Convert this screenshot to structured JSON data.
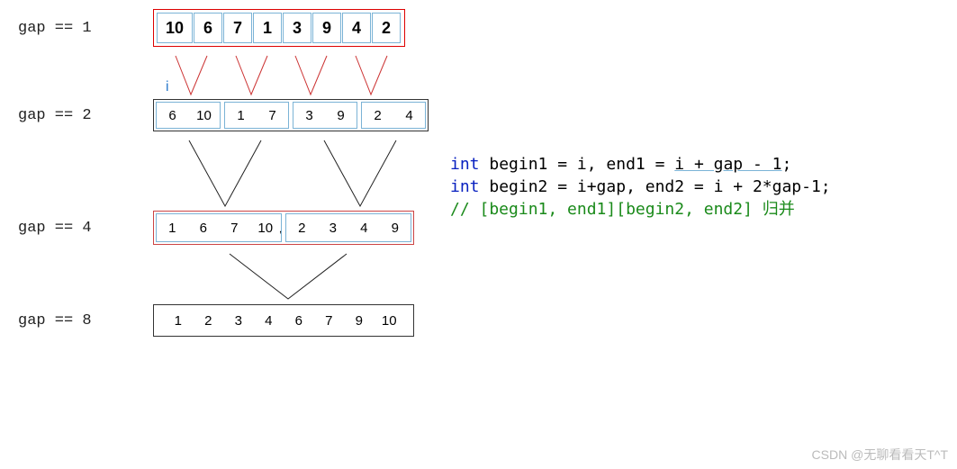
{
  "labels": {
    "gap1": "gap == 1",
    "gap2": "gap == 2",
    "gap4": "gap == 4",
    "gap8": "gap == 8",
    "i": "i"
  },
  "rows": {
    "gap1": [
      "10",
      "6",
      "7",
      "1",
      "3",
      "9",
      "4",
      "2"
    ],
    "gap2": [
      [
        "6",
        "10"
      ],
      [
        "1",
        "7"
      ],
      [
        "3",
        "9"
      ],
      [
        "2",
        "4"
      ]
    ],
    "gap4": [
      [
        "1",
        "6",
        "7",
        "10"
      ],
      [
        "2",
        "3",
        "4",
        "9"
      ]
    ],
    "gap8": [
      "1",
      "2",
      "3",
      "4",
      "6",
      "7",
      "9",
      "10"
    ]
  },
  "code": {
    "line1": {
      "kw": "int",
      "body": " begin1 = i, end1 = ",
      "expr": "i + gap - 1",
      "end": ";"
    },
    "line2": {
      "kw": "int",
      "body": " begin2 = i+gap, end2 = i + 2*gap-1;"
    },
    "line3": "// [begin1, end1][begin2, end2] 归并"
  },
  "watermark": "CSDN @无聊看看天T^T"
}
